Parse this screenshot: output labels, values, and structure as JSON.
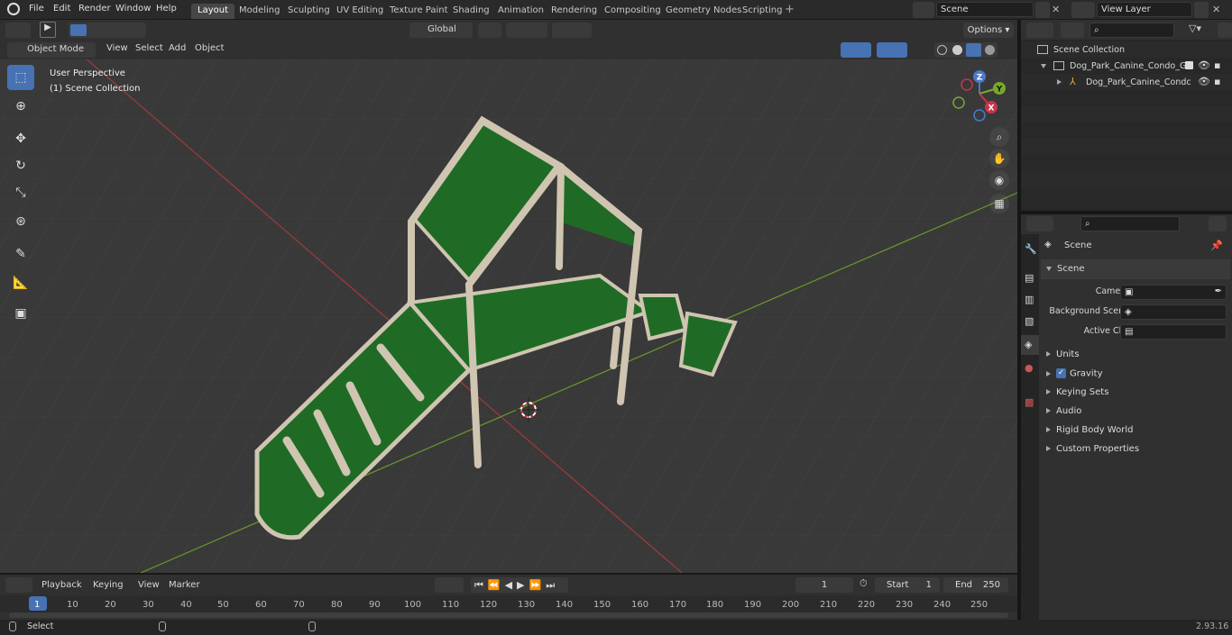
{
  "topbar": {
    "menus": [
      "File",
      "Edit",
      "Render",
      "Window",
      "Help"
    ],
    "workspaces": [
      "Layout",
      "Modeling",
      "Sculpting",
      "UV Editing",
      "Texture Paint",
      "Shading",
      "Animation",
      "Rendering",
      "Compositing",
      "Geometry Nodes",
      "Scripting"
    ],
    "active_workspace": "Layout",
    "scene_name": "Scene",
    "view_layer": "View Layer"
  },
  "view3d_header": {
    "transform_orientation": "Global",
    "options_label": "Options",
    "mode": "Object Mode",
    "menus": [
      "View",
      "Select",
      "Add",
      "Object"
    ]
  },
  "viewport": {
    "perspective_label": "User Perspective",
    "collection_label": "(1) Scene Collection",
    "axes": {
      "x": "X",
      "y": "Y",
      "z": "Z"
    }
  },
  "outliner": {
    "root": "Scene Collection",
    "items": [
      {
        "label": "Dog_Park_Canine_Condo_Gre"
      },
      {
        "label": "Dog_Park_Canine_Condc"
      }
    ]
  },
  "properties": {
    "context_title": "Scene",
    "panel_title": "Scene",
    "fields": [
      {
        "label": "Camera",
        "value": ""
      },
      {
        "label": "Background Scene",
        "value": ""
      },
      {
        "label": "Active Clip",
        "value": ""
      }
    ],
    "subpanels": [
      "Units",
      "Gravity",
      "Keying Sets",
      "Audio",
      "Rigid Body World",
      "Custom Properties"
    ],
    "gravity_checked": true
  },
  "timeline": {
    "menus": [
      "Playback",
      "Keying",
      "View",
      "Marker"
    ],
    "current_frame": "1",
    "start_label": "Start",
    "start_value": "1",
    "end_label": "End",
    "end_value": "250",
    "ticks": [
      "1",
      "10",
      "20",
      "30",
      "40",
      "50",
      "60",
      "70",
      "80",
      "90",
      "100",
      "110",
      "120",
      "130",
      "140",
      "150",
      "160",
      "170",
      "180",
      "190",
      "200",
      "210",
      "220",
      "230",
      "240",
      "250"
    ]
  },
  "status": {
    "left": "Select",
    "version": "2.93.16"
  },
  "colors": {
    "accent": "#4772b3",
    "model_green": "#1f6b26",
    "model_frame": "#cfc5b0",
    "x_axis": "#a23a3a",
    "y_axis": "#6a9a2a"
  }
}
